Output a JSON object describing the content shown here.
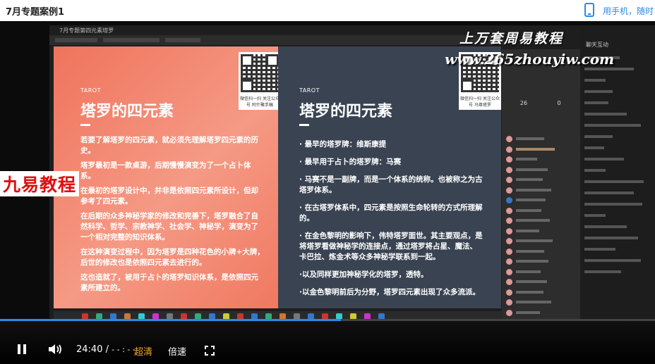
{
  "page": {
    "title": "7月专题案例1",
    "mobile_link": "用手机，随时"
  },
  "recording": {
    "window_title": "7月专题第四元素塔罗",
    "watermark_line1": "上万套周易教程",
    "watermark_line2": "www.265zhouyiw.com"
  },
  "overlay": {
    "jiuyi_label": "九易教程"
  },
  "slide": {
    "left": {
      "kicker": "TAROT",
      "heading": "塔罗的四元素",
      "paragraphs": [
        "若要了解塔罗的四元素，就必须先理解塔罗四元素的历史。",
        "塔罗最初是一款桌游，后期慢慢演变为了一个占卜体系。",
        "在最初的塔罗设计中，并非是依照四元素所设计，但却参考了四元素。",
        "在后期的众多神秘学家的修改和完善下，塔罗融合了自然科学、哲学、宗教神学、社会学、神秘学，演变为了一个相对完整的知识体系。",
        "在这种演变过程中，因为塔罗是四种花色的小牌+大牌，后世的修改也是依照四元素去进行的。",
        "这也造就了，被用于占卜的塔罗知识体系，是依照四元素所建立的。"
      ],
      "qr_caption": "微信扫一扫 关注公众号 阿什聚手稿"
    },
    "right": {
      "kicker": "TAROT",
      "heading": "塔罗的四元素",
      "bullets": [
        "· 最早的塔罗牌：维斯康提",
        "· 最早用于占卜的塔罗牌：马赛",
        "· 马赛不是一副牌，而是一个体系的统称。也被称之为古塔罗体系。",
        "· 在古塔罗体系中，四元素是按照生命轮转的方式所理解的。",
        "· 在金色黎明的影响下，伟特塔罗面世。其主要观点，是将塔罗看做神秘学的连接点，通过塔罗将占星、魔法、卡巴拉、炼金术等众多神秘学联系到一起。",
        "·以及同样更加神秘学化的塔罗，透特。",
        "·以金色黎明前后为分野，塔罗四元素出现了众多流派。"
      ],
      "qr_caption": "微信扫一扫 关注公众号 马尊塔罗"
    }
  },
  "side_panel": {
    "stat_left": "26",
    "stat_right": "0"
  },
  "chat_panel": {
    "header": "聊天互动"
  },
  "player": {
    "progress_fraction": 0.52,
    "current_time": "24:40",
    "separator": "/",
    "duration": "- - : - -",
    "quality_label": "超清",
    "speed_label": "倍速"
  },
  "icons": {
    "play_pause": "pause-icon",
    "volume": "volume-icon",
    "fullscreen": "fullscreen-icon",
    "phone": "phone-icon"
  },
  "colors": {
    "accent": "#2b8ae6",
    "quality": "#f5a623",
    "slide_left": "#f0735c",
    "slide_right": "#394352",
    "jiuyi_red": "#e00e0e"
  }
}
